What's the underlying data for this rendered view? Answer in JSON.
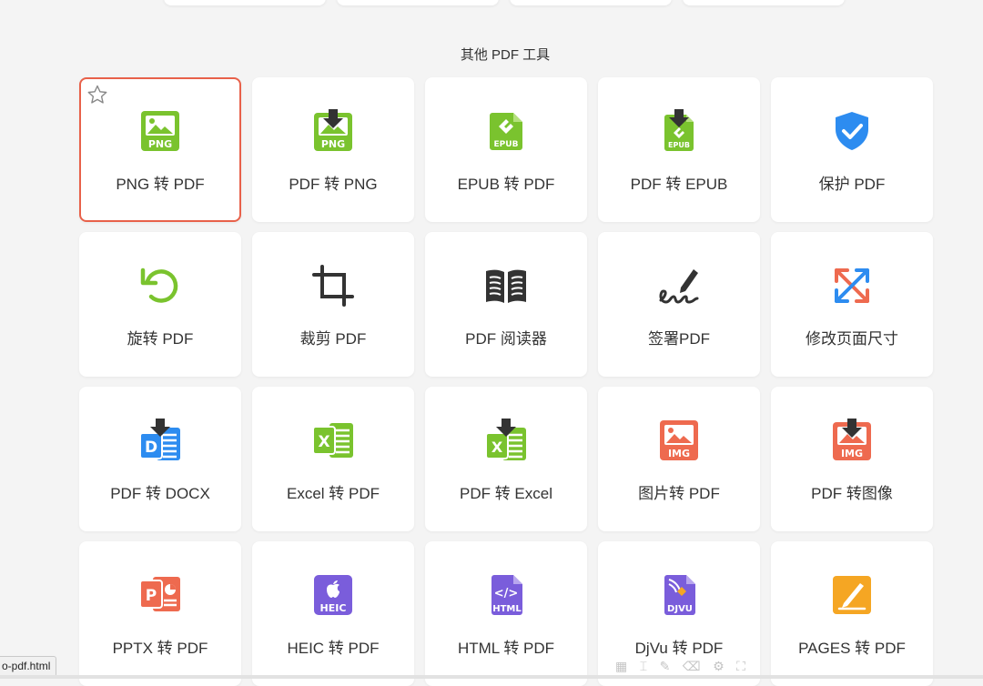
{
  "section_title": "其他 PDF 工具",
  "tools": [
    {
      "label": "PNG 转 PDF",
      "icon": "png-to-pdf-icon",
      "selected": true
    },
    {
      "label": "PDF 转 PNG",
      "icon": "pdf-to-png-icon"
    },
    {
      "label": "EPUB 转 PDF",
      "icon": "epub-to-pdf-icon"
    },
    {
      "label": "PDF 转 EPUB",
      "icon": "pdf-to-epub-icon"
    },
    {
      "label": "保护 PDF",
      "icon": "shield-icon"
    },
    {
      "label": "旋转 PDF",
      "icon": "rotate-icon"
    },
    {
      "label": "裁剪 PDF",
      "icon": "crop-icon"
    },
    {
      "label": "PDF 阅读器",
      "icon": "book-icon"
    },
    {
      "label": "签署PDF",
      "icon": "signature-icon"
    },
    {
      "label": "修改页面尺寸",
      "icon": "resize-icon"
    },
    {
      "label": "PDF 转 DOCX",
      "icon": "pdf-to-docx-icon"
    },
    {
      "label": "Excel 转 PDF",
      "icon": "excel-to-pdf-icon"
    },
    {
      "label": "PDF 转 Excel",
      "icon": "pdf-to-excel-icon"
    },
    {
      "label": "图片转 PDF",
      "icon": "image-to-pdf-icon"
    },
    {
      "label": "PDF 转图像",
      "icon": "pdf-to-image-icon"
    },
    {
      "label": "PPTX 转 PDF",
      "icon": "pptx-to-pdf-icon"
    },
    {
      "label": "HEIC 转 PDF",
      "icon": "heic-to-pdf-icon"
    },
    {
      "label": "HTML 转 PDF",
      "icon": "html-to-pdf-icon"
    },
    {
      "label": "DjVu 转 PDF",
      "icon": "djvu-to-pdf-icon"
    },
    {
      "label": "PAGES 转 PDF",
      "icon": "pages-to-pdf-icon"
    }
  ],
  "status_url": "o-pdf.html",
  "icon_text": {
    "png": "PNG",
    "epub": "EPUB",
    "img": "IMG",
    "heic": "HEIC",
    "html": "HTML",
    "djvu": "DJVU",
    "p": "P",
    "x": "X",
    "d": "D",
    "code": "</>"
  },
  "colors": {
    "green": "#7ac32e",
    "blue": "#2d8cf0",
    "red": "#ee6a4f",
    "purple": "#7a5ddb",
    "orange": "#f5a623",
    "dark": "#333333",
    "selected_border": "#e8614a"
  }
}
